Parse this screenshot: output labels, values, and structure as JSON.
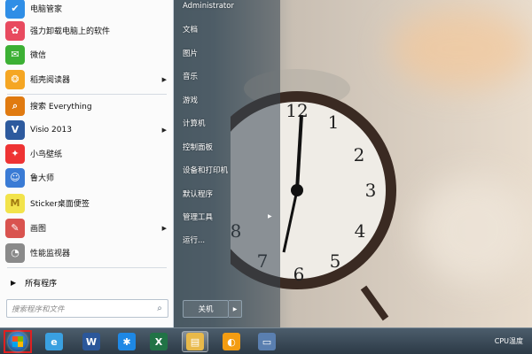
{
  "left_menu": {
    "items": [
      {
        "label": "电脑管家",
        "icon": "shield-icon",
        "color": "#2f8ee6",
        "submenu": false
      },
      {
        "label": "强力卸载电脑上的软件",
        "icon": "multicolor-petal-icon",
        "color": "#e84a5f",
        "submenu": false
      },
      {
        "label": "微信",
        "icon": "wechat-icon",
        "color": "#3cb034",
        "submenu": false
      },
      {
        "label": "稻壳阅读器",
        "icon": "reader-icon",
        "color": "#f5a623",
        "submenu": true
      },
      {
        "label": "搜索 Everything",
        "icon": "magnifier-icon",
        "color": "#e07a10",
        "submenu": false
      },
      {
        "label": "Visio 2013",
        "icon": "visio-icon",
        "color": "#2d5a9e",
        "submenu": true
      },
      {
        "label": "小鸟壁纸",
        "icon": "bird-icon",
        "color": "#e33",
        "submenu": false
      },
      {
        "label": "鲁大师",
        "icon": "ludashi-icon",
        "color": "#3a7bd5",
        "submenu": false
      },
      {
        "label": "Sticker桌面便签",
        "icon": "sticky-note-icon",
        "color": "#f2e34b",
        "submenu": false
      },
      {
        "label": "画图",
        "icon": "paint-icon",
        "color": "#d9534f",
        "submenu": true
      },
      {
        "label": "性能监视器",
        "icon": "monitor-gauge-icon",
        "color": "#8a8a8a",
        "submenu": false
      }
    ],
    "all_programs": "所有程序",
    "search_placeholder": "搜索程序和文件"
  },
  "right_menu": {
    "user": "Administrator",
    "items": [
      {
        "label": "文档",
        "submenu": false
      },
      {
        "label": "图片",
        "submenu": false
      },
      {
        "label": "音乐",
        "submenu": false
      },
      {
        "label": "游戏",
        "submenu": false
      },
      {
        "label": "计算机",
        "submenu": false
      },
      {
        "label": "控制面板",
        "submenu": false
      },
      {
        "label": "设备和打印机",
        "submenu": false
      },
      {
        "label": "默认程序",
        "submenu": false
      },
      {
        "label": "管理工具",
        "submenu": true
      },
      {
        "label": "运行...",
        "submenu": false
      }
    ],
    "shutdown": "关机"
  },
  "taskbar": {
    "apps": [
      {
        "name": "ie-icon",
        "active": false
      },
      {
        "name": "word-icon",
        "active": false
      },
      {
        "name": "star-app-icon",
        "active": false
      },
      {
        "name": "excel-icon",
        "active": false
      },
      {
        "name": "file-explorer-icon",
        "active": true
      },
      {
        "name": "orange-browser-icon",
        "active": false
      },
      {
        "name": "display-settings-icon",
        "active": false
      }
    ],
    "tray_text": "CPU温度"
  },
  "colors": {
    "highlight_red": "#e02020",
    "menu_bg": "#fbfbfb",
    "taskbar": "#3a4a58"
  }
}
